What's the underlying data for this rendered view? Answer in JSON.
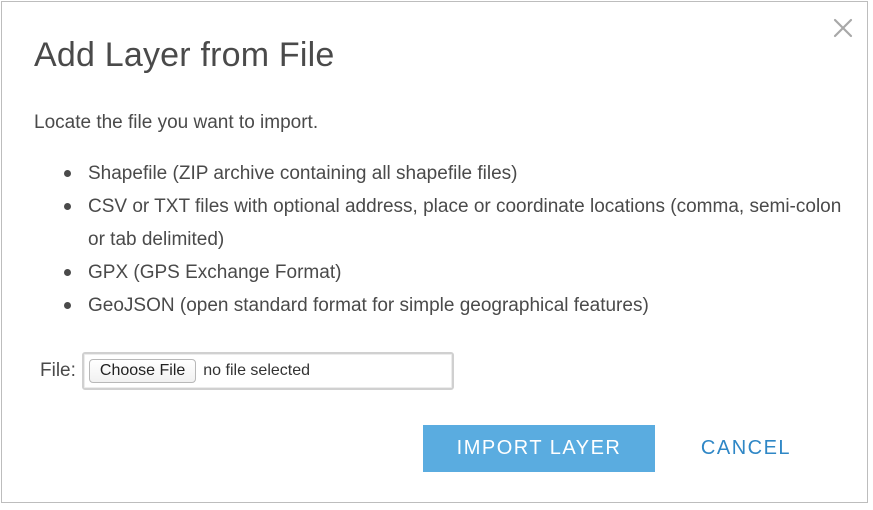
{
  "dialog": {
    "title": "Add Layer from File",
    "intro": "Locate the file you want to import.",
    "formats": [
      "Shapefile (ZIP archive containing all shapefile files)",
      "CSV or TXT files with optional address, place or coordinate locations (comma, semi-colon or tab delimited)",
      "GPX (GPS Exchange Format)",
      "GeoJSON (open standard format for simple geographical features)"
    ],
    "file_label": "File:",
    "choose_file_label": "Choose File",
    "file_status": "no file selected",
    "import_label": "IMPORT LAYER",
    "cancel_label": "CANCEL",
    "close_icon": "close-icon"
  },
  "colors": {
    "primary_button": "#5aace0",
    "link_button": "#2f87c6",
    "text": "#4a4a4a"
  }
}
